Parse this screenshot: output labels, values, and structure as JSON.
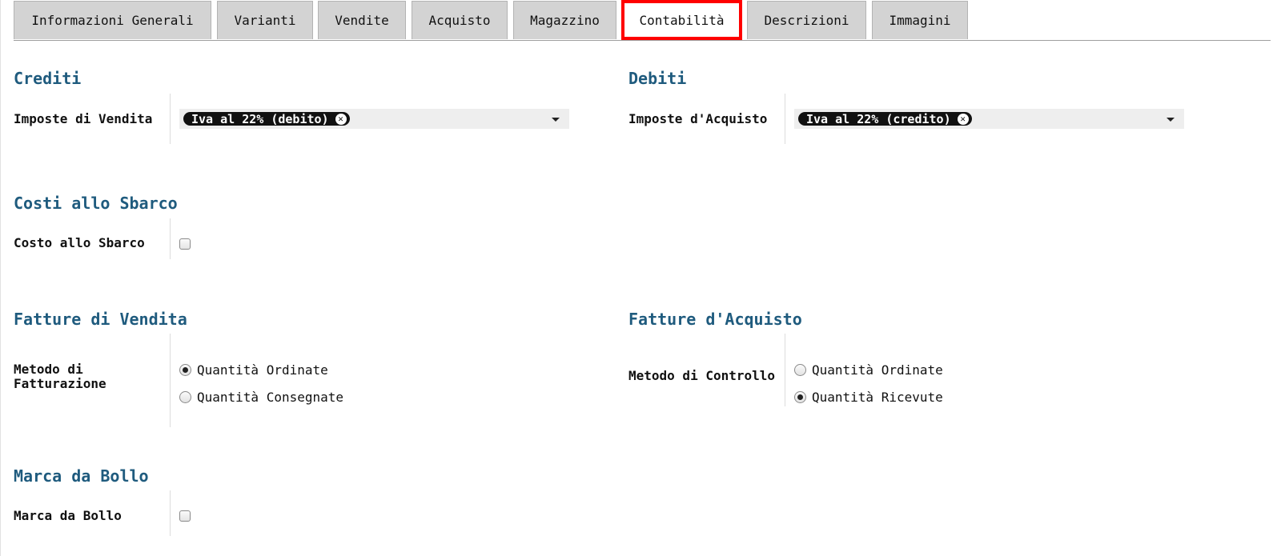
{
  "tabs": [
    {
      "label": "Informazioni Generali",
      "active": false
    },
    {
      "label": "Varianti",
      "active": false
    },
    {
      "label": "Vendite",
      "active": false
    },
    {
      "label": "Acquisto",
      "active": false
    },
    {
      "label": "Magazzino",
      "active": false
    },
    {
      "label": "Contabilità",
      "active": true
    },
    {
      "label": "Descrizioni",
      "active": false
    },
    {
      "label": "Immagini",
      "active": false
    }
  ],
  "crediti": {
    "title": "Crediti",
    "field_label": "Imposte di Vendita",
    "tag": "Iva al 22% (debito)"
  },
  "debiti": {
    "title": "Debiti",
    "field_label": "Imposte d'Acquisto",
    "tag": "Iva al 22% (credito)"
  },
  "costi": {
    "title": "Costi allo Sbarco",
    "field_label": "Costo allo Sbarco",
    "checked": false
  },
  "fatture_vendita": {
    "title": "Fatture di Vendita",
    "field_label_line1": "Metodo di",
    "field_label_line2": "Fatturazione",
    "options": [
      {
        "label": "Quantità Ordinate",
        "checked": true
      },
      {
        "label": "Quantità Consegnate",
        "checked": false
      }
    ]
  },
  "fatture_acquisto": {
    "title": "Fatture d'Acquisto",
    "field_label": "Metodo di Controllo",
    "options": [
      {
        "label": "Quantità Ordinate",
        "checked": false
      },
      {
        "label": "Quantità Ricevute",
        "checked": true
      }
    ]
  },
  "marca": {
    "title": "Marca da Bollo",
    "field_label": "Marca da Bollo",
    "checked": false
  }
}
